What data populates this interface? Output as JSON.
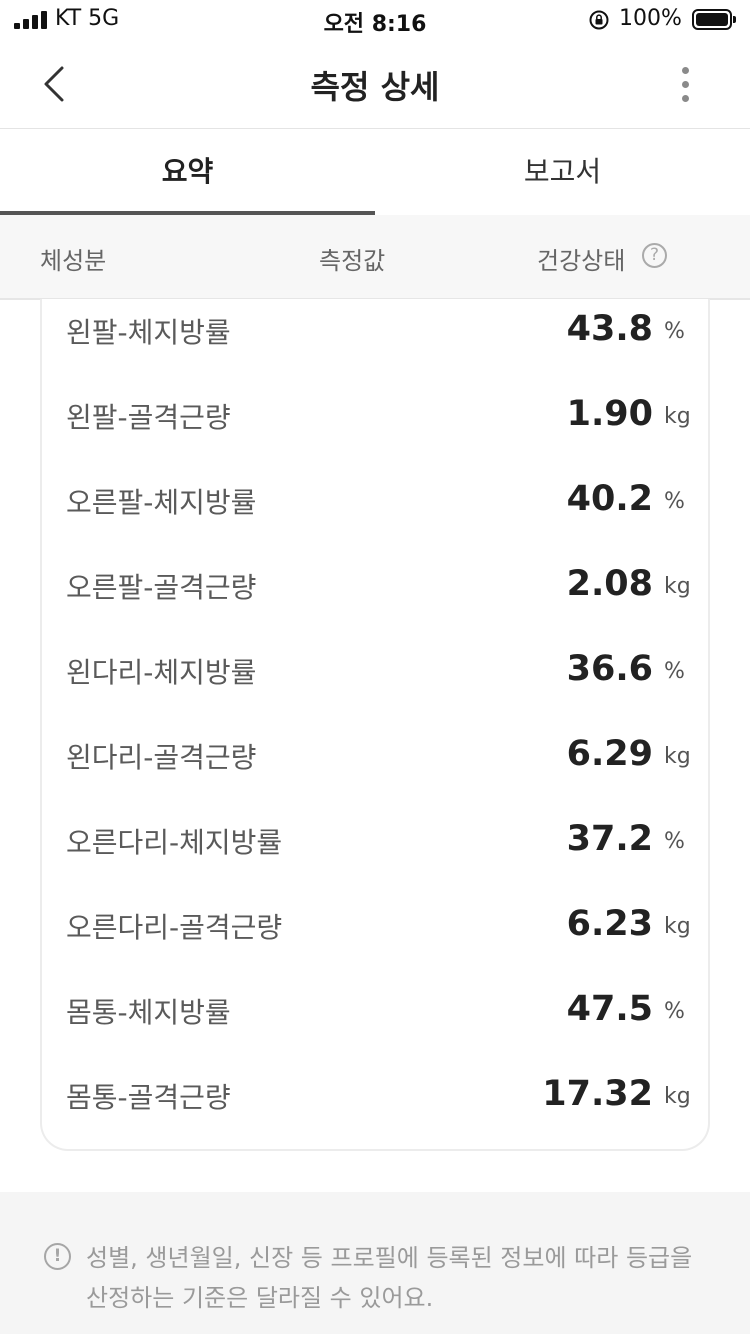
{
  "status_bar": {
    "carrier": "KT  5G",
    "time": "오전 8:16",
    "battery": "100%"
  },
  "nav": {
    "title": "측정 상세",
    "back_icon": "chevron-left-icon",
    "more_icon": "more-vertical-icon"
  },
  "tabs": [
    {
      "label": "요약",
      "active": true
    },
    {
      "label": "보고서",
      "active": false
    }
  ],
  "columns": {
    "composition": "체성분",
    "value": "측정값",
    "health": "건강상태",
    "help_icon": "question-circle-icon"
  },
  "rows": [
    {
      "label": "왼팔-체지방률",
      "value": "43.8",
      "unit": "%"
    },
    {
      "label": "왼팔-골격근량",
      "value": "1.90",
      "unit": "kg"
    },
    {
      "label": "오른팔-체지방률",
      "value": "40.2",
      "unit": "%"
    },
    {
      "label": "오른팔-골격근량",
      "value": "2.08",
      "unit": "kg"
    },
    {
      "label": "왼다리-체지방률",
      "value": "36.6",
      "unit": "%"
    },
    {
      "label": "왼다리-골격근량",
      "value": "6.29",
      "unit": "kg"
    },
    {
      "label": "오른다리-체지방률",
      "value": "37.2",
      "unit": "%"
    },
    {
      "label": "오른다리-골격근량",
      "value": "6.23",
      "unit": "kg"
    },
    {
      "label": "몸통-체지방률",
      "value": "47.5",
      "unit": "%"
    },
    {
      "label": "몸통-골격근량",
      "value": "17.32",
      "unit": "kg"
    }
  ],
  "notice": {
    "icon": "alert-circle-icon",
    "line1": "성별, 생년월일, 신장 등 프로필에 등록된 정보에 따라 등급을",
    "line2": "산정하는 기준은 달라질 수 있어요."
  }
}
